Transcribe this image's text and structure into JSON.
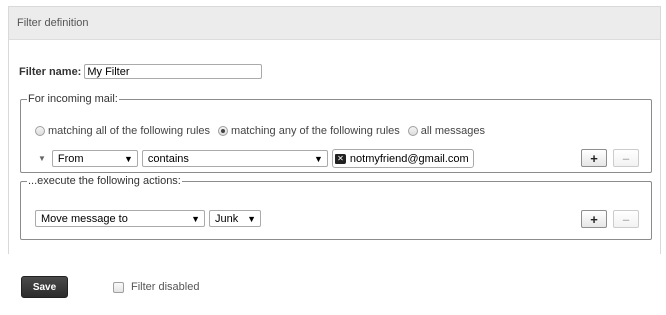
{
  "header": {
    "title": "Filter definition"
  },
  "filter_name": {
    "label": "Filter name:",
    "value": "My Filter"
  },
  "incoming": {
    "legend": "For incoming mail:",
    "options": [
      {
        "label": "matching all of the following rules",
        "checked": false
      },
      {
        "label": "matching any of the following rules",
        "checked": true
      },
      {
        "label": "all messages",
        "checked": false
      }
    ],
    "rule": {
      "field": "From",
      "operator": "contains",
      "value": "notmyfriend@gmail.com",
      "add_label": "+",
      "remove_label": "–"
    }
  },
  "actions": {
    "legend": "...execute the following actions:",
    "action": "Move message to",
    "target": "Junk",
    "add_label": "+",
    "remove_label": "–"
  },
  "footer": {
    "save_label": "Save",
    "disabled_label": "Filter disabled",
    "disabled_checked": false
  }
}
